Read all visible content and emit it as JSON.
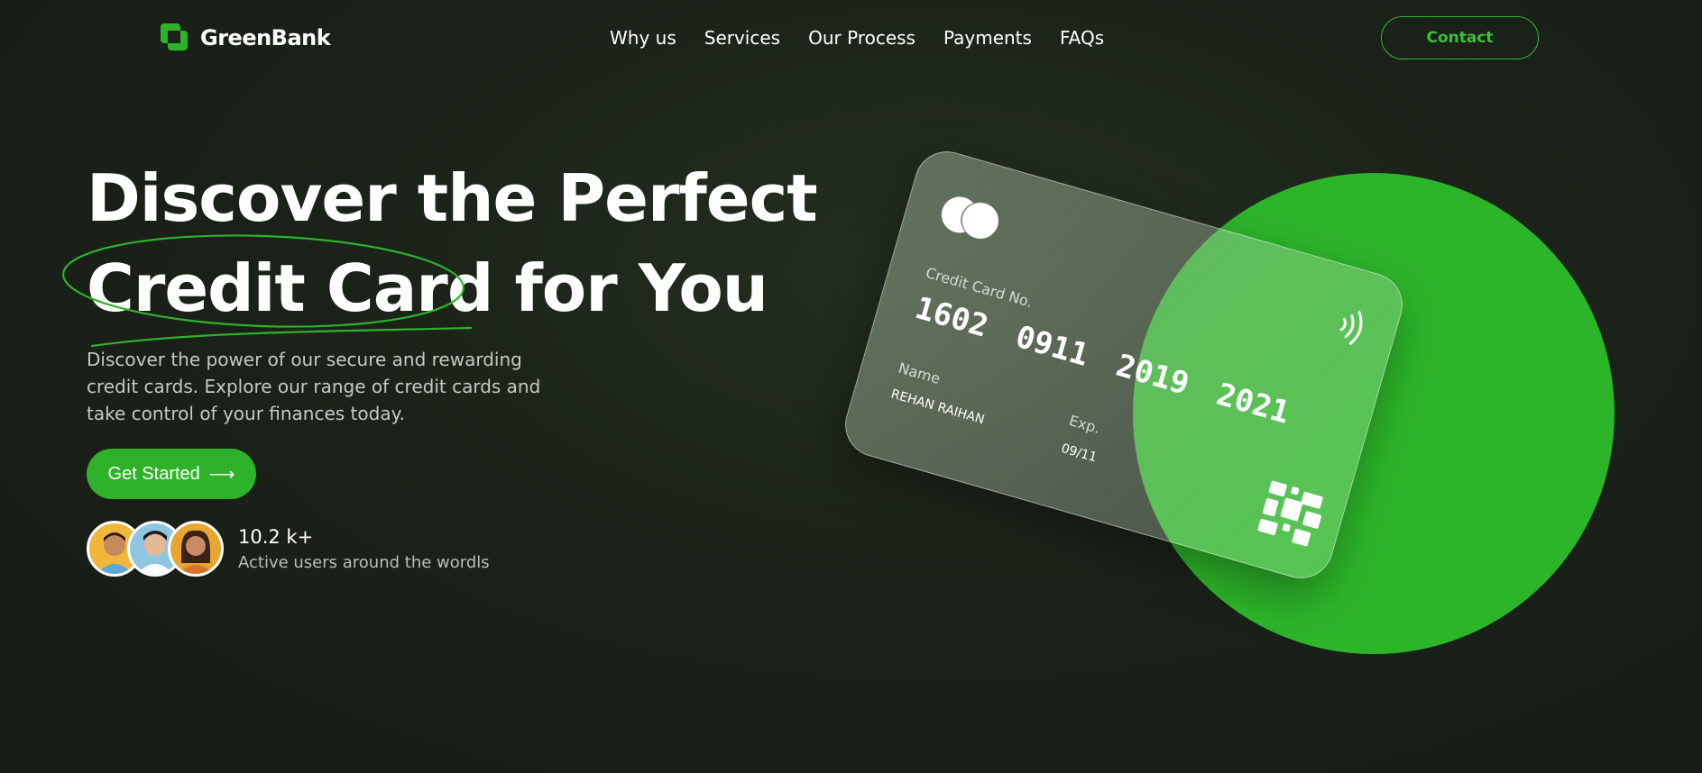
{
  "header": {
    "brand": "GreenBank",
    "nav": [
      "Why us",
      "Services",
      "Our Process",
      "Payments",
      "FAQs"
    ],
    "contact_label": "Contact"
  },
  "hero": {
    "headline_line1": "Discover the Perfect",
    "headline_highlight": "Credit Card",
    "headline_rest": "for You",
    "subtext": "Discover the power of our secure and rewarding credit cards. Explore our range of credit cards and take control of your finances today.",
    "cta_label": "Get Started",
    "cta_arrow": "⟶",
    "users_count": "10.2 k+",
    "users_label": "Active users around the wordls"
  },
  "card": {
    "number_label": "Credit Card No.",
    "number_groups": [
      "1602",
      "0911",
      "2019",
      "2021"
    ],
    "name_label": "Name",
    "name": "REHAN RAIHAN",
    "exp_label": "Exp.",
    "exp": "09/11",
    "icons": [
      "mastercard-logo-icon",
      "contactless-icon",
      "chip-icon"
    ]
  },
  "colors": {
    "accent": "#2eb22a",
    "background": "#1b2219",
    "text": "#ffffff",
    "muted": "#c4cac3"
  },
  "icons": [
    "logo-icon",
    "arrow-right-icon"
  ]
}
